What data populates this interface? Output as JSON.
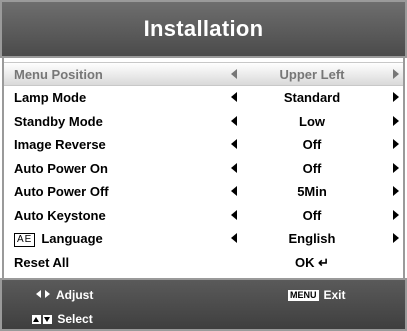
{
  "window": {
    "title": "Installation"
  },
  "menu": {
    "items": [
      {
        "label": "Menu Position",
        "value": "Upper Left",
        "has_arrows": true,
        "selected": true
      },
      {
        "label": "Lamp Mode",
        "value": "Standard",
        "has_arrows": true,
        "selected": false
      },
      {
        "label": "Standby Mode",
        "value": "Low",
        "has_arrows": true,
        "selected": false
      },
      {
        "label": "Image Reverse",
        "value": "Off",
        "has_arrows": true,
        "selected": false
      },
      {
        "label": "Auto Power On",
        "value": "Off",
        "has_arrows": true,
        "selected": false
      },
      {
        "label": "Auto Power Off",
        "value": "5Min",
        "has_arrows": true,
        "selected": false
      },
      {
        "label": "Auto Keystone",
        "value": "Off",
        "has_arrows": true,
        "selected": false
      },
      {
        "label": "Language",
        "value": "English",
        "has_arrows": true,
        "selected": false,
        "icon_text": "AE"
      },
      {
        "label": "Reset All",
        "value": "OK",
        "has_arrows": false,
        "selected": false,
        "value_icon": "enter-icon"
      }
    ]
  },
  "footer": {
    "adjust_label": "Adjust",
    "select_label": "Select",
    "menu_key_label": "MENU",
    "exit_label": "Exit"
  },
  "colors": {
    "title_bg": "#5a5a5a",
    "selected_text": "#777777",
    "text": "#000000",
    "footer_bg": "#4a4a4a"
  }
}
